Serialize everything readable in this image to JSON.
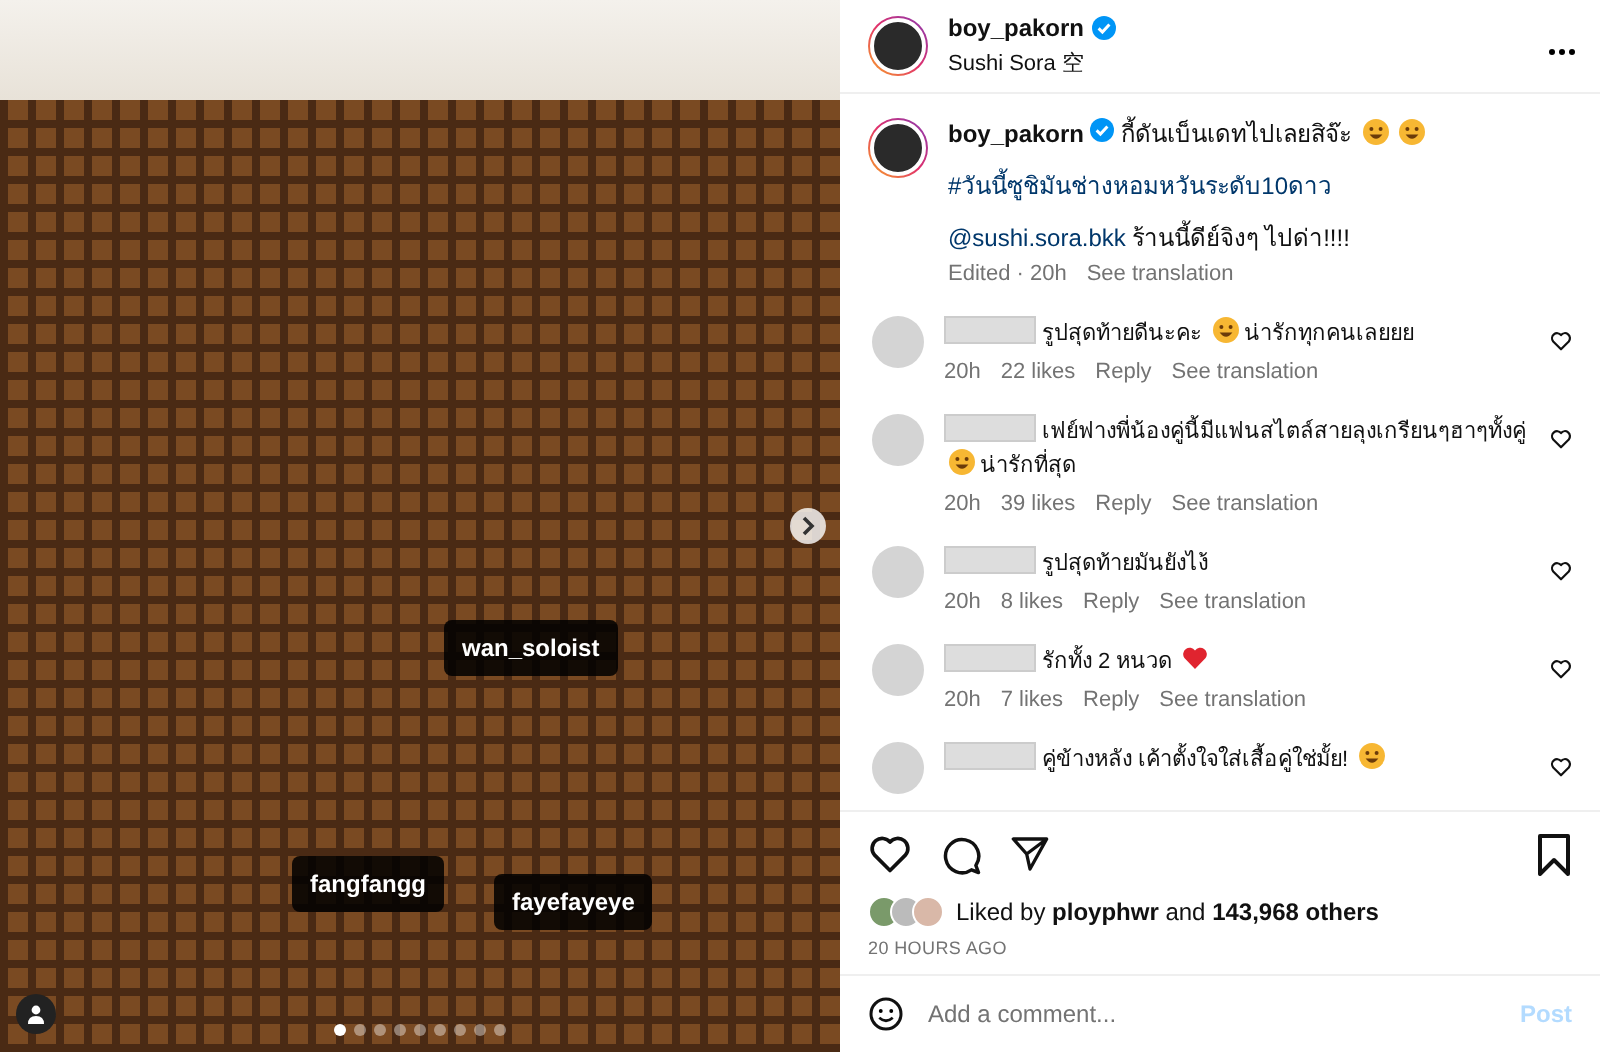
{
  "photo": {
    "tags": [
      {
        "label": "wan_soloist"
      },
      {
        "label": "fangfangg"
      },
      {
        "label": "fayefayeye"
      }
    ],
    "slides": [
      {
        "selected": true
      },
      {
        "selected": false
      },
      {
        "selected": false
      },
      {
        "selected": false
      },
      {
        "selected": false
      },
      {
        "selected": false
      },
      {
        "selected": false
      },
      {
        "selected": false
      },
      {
        "selected": false
      }
    ]
  },
  "header": {
    "username": "boy_pakorn",
    "location": "Sushi Sora 空"
  },
  "caption": {
    "username": "boy_pakorn",
    "parts": [
      {
        "kind": "text",
        "text": "กี้ดันเบ็นเดทไปเลยสิจ๊ะ"
      },
      {
        "kind": "emoji"
      },
      {
        "kind": "emoji"
      }
    ],
    "hashtag": "#วันนี้ซูชิมันช่างหอมหวันระดับ10ดาว",
    "mention": "@sushi.sora.bkk",
    "mention_text": "ร้านนี้ดีย์จิงๆ ไปด่า!!!!",
    "edited": "Edited · 20h",
    "translate": "See translation"
  },
  "comments": [
    {
      "parts": [
        {
          "kind": "text",
          "text": "รูปสุดท้ายดีนะคะ"
        },
        {
          "kind": "emoji"
        },
        {
          "kind": "text",
          "text": "น่ารักทุกคนเลยยย"
        }
      ],
      "time": "20h",
      "likes": "22 likes",
      "reply": "Reply",
      "translate": "See translation"
    },
    {
      "parts": [
        {
          "kind": "text",
          "text": "เฟย์ฟางพี่น้องคู่นี้มีแฟนสไตล์สายลุงเกรียนๆฮาๆทั้งคู่"
        },
        {
          "kind": "emoji"
        },
        {
          "kind": "text",
          "text": "น่ารักที่สุด"
        }
      ],
      "time": "20h",
      "likes": "39 likes",
      "reply": "Reply",
      "translate": "See translation"
    },
    {
      "parts": [
        {
          "kind": "text",
          "text": "รูปสุดท้ายมันยังไง้"
        }
      ],
      "time": "20h",
      "likes": "8 likes",
      "reply": "Reply",
      "translate": "See translation"
    },
    {
      "parts": [
        {
          "kind": "text",
          "text": "รักทั้ง 2 หนวด"
        },
        {
          "kind": "heart"
        }
      ],
      "time": "20h",
      "likes": "7 likes",
      "reply": "Reply",
      "translate": "See translation"
    },
    {
      "parts": [
        {
          "kind": "text",
          "text": "คู่ข้างหลัง เค้าตั้งใจใส่เสื้อคู่ใช่มั้ย!"
        },
        {
          "kind": "emoji"
        }
      ]
    }
  ],
  "likes": {
    "text": "Liked by **ployphwr** and **143,968 others**",
    "time": "20 HOURS AGO"
  },
  "composer": {
    "placeholder": "Add a comment...",
    "post": "Post",
    "post_disabled": true
  }
}
